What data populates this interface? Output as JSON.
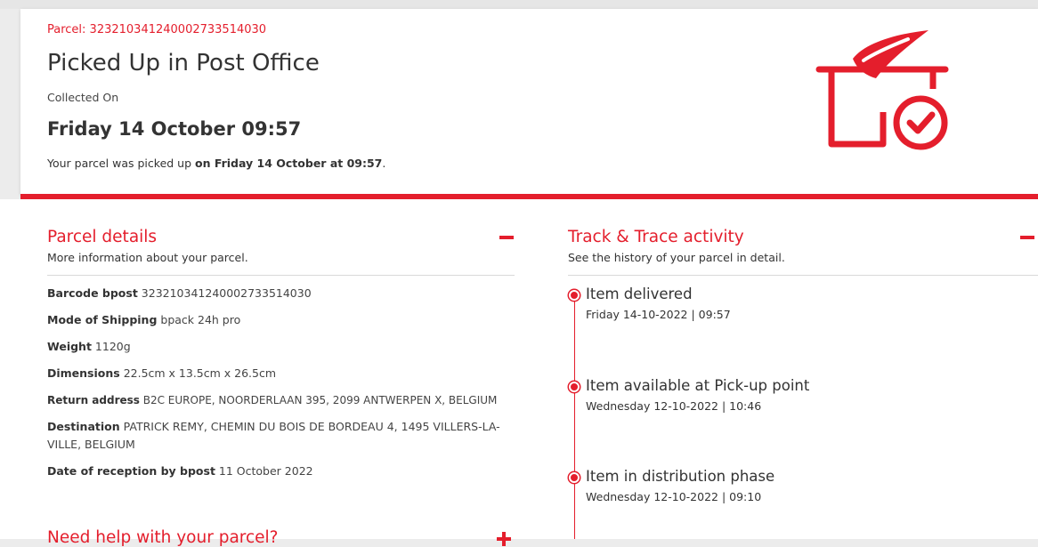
{
  "header": {
    "parcel_label": "Parcel: 323210341240002733514030",
    "status_title": "Picked Up in Post Office",
    "collected_label": "Collected On",
    "collected_date": "Friday 14 October 09:57",
    "pickup_msg_prefix": "Your parcel was picked up ",
    "pickup_msg_bold": "on Friday 14 October at 09:57",
    "pickup_msg_suffix": "."
  },
  "parcel_details": {
    "title": "Parcel details",
    "subtitle": "More information about your parcel.",
    "rows": [
      {
        "label": "Barcode bpost",
        "value": "323210341240002733514030"
      },
      {
        "label": "Mode of Shipping",
        "value": "bpack 24h pro"
      },
      {
        "label": "Weight",
        "value": "1120g"
      },
      {
        "label": "Dimensions",
        "value": "22.5cm x 13.5cm x 26.5cm"
      },
      {
        "label": "Return address",
        "value": "B2C EUROPE, NOORDERLAAN 395, 2099 ANTWERPEN X, BELGIUM"
      },
      {
        "label": "Destination",
        "value": "PATRICK REMY, CHEMIN DU BOIS DE BORDEAU 4, 1495 VILLERS-LA-VILLE, BELGIUM"
      },
      {
        "label": "Date of reception by bpost",
        "value": "11 October 2022"
      }
    ]
  },
  "help": {
    "title": "Need help with your parcel?"
  },
  "track_trace": {
    "title": "Track & Trace activity",
    "subtitle": "See the history of your parcel in detail.",
    "events": [
      {
        "title": "Item delivered",
        "time": "Friday 14-10-2022 | 09:57"
      },
      {
        "title": "Item available at Pick-up point",
        "time": "Wednesday 12-10-2022 | 10:46"
      },
      {
        "title": "Item in distribution phase",
        "time": "Wednesday 12-10-2022 | 09:10"
      }
    ]
  },
  "colors": {
    "accent": "#e41e2c",
    "text": "#333333",
    "background": "#ececec"
  },
  "icons": {
    "hero": "parcel-picked-up-icon",
    "timeline_dot": "timeline-dot-icon"
  }
}
